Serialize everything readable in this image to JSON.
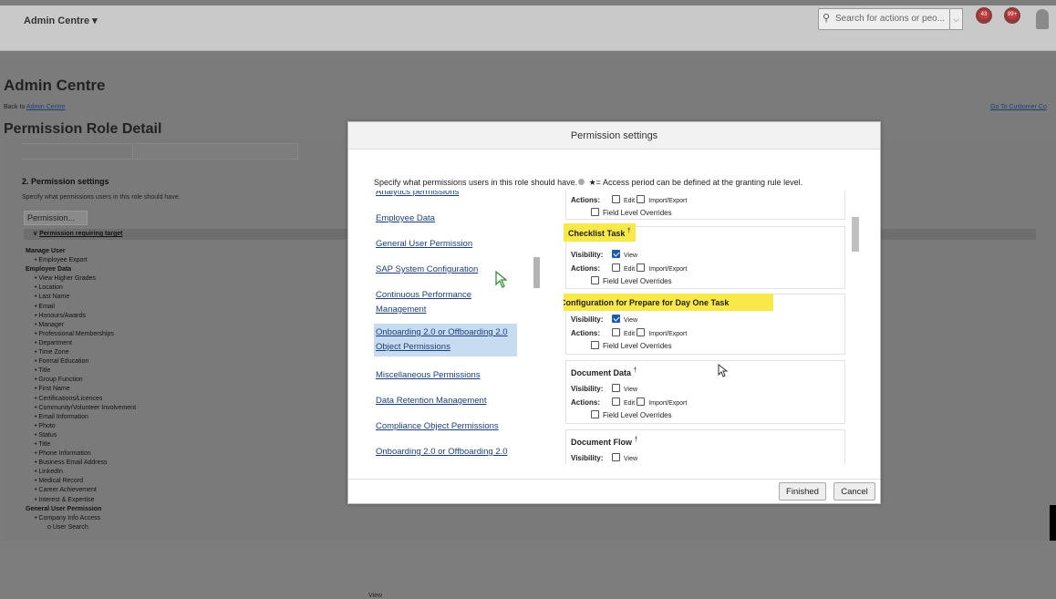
{
  "topbar": {
    "app_title": "Admin Centre ▾",
    "search_placeholder": "Search for actions or peo...",
    "dropdown_icon": "⌵",
    "notif_badges": [
      "43",
      "99+"
    ]
  },
  "page": {
    "heading": "Admin Centre",
    "back_prefix": "Back to ",
    "back_link": "Admin Centre",
    "go_to_link": "Go To Customer Co",
    "subheading": "Permission Role Detail",
    "section_title": "2. Permission settings",
    "section_desc": "Specify what permissions users in this role should have.",
    "permission_button": "Permission...",
    "requiring_target": "Permission requiring target",
    "requiring_target_prefix": "∨ ",
    "tree": [
      {
        "t": "g",
        "text": "Manage User"
      },
      {
        "t": "i",
        "text": "Employee Export"
      },
      {
        "t": "g",
        "text": "Employee Data"
      },
      {
        "t": "i",
        "text": "View Higher Grades"
      },
      {
        "t": "i",
        "text": "Location"
      },
      {
        "t": "i",
        "text": "Last Name"
      },
      {
        "t": "i",
        "text": "Email"
      },
      {
        "t": "i",
        "text": "Honours/Awards"
      },
      {
        "t": "i",
        "text": "Manager"
      },
      {
        "t": "i",
        "text": "Professional Memberships"
      },
      {
        "t": "i",
        "text": "Department"
      },
      {
        "t": "i",
        "text": "Time Zone"
      },
      {
        "t": "i",
        "text": "Formal Education"
      },
      {
        "t": "i",
        "text": "Title"
      },
      {
        "t": "i",
        "text": "Group Function"
      },
      {
        "t": "i",
        "text": "First Name"
      },
      {
        "t": "i",
        "text": "Certifications/Licences"
      },
      {
        "t": "i",
        "text": "Community/Volunteer Involvement"
      },
      {
        "t": "i",
        "text": "Email Information"
      },
      {
        "t": "i",
        "text": "Photo"
      },
      {
        "t": "i",
        "text": "Status"
      },
      {
        "t": "i",
        "text": "Title"
      },
      {
        "t": "i",
        "text": "Phone Information"
      },
      {
        "t": "i",
        "text": "Business Email Address"
      },
      {
        "t": "i",
        "text": "LinkedIn"
      },
      {
        "t": "i",
        "text": "Medical Record"
      },
      {
        "t": "i",
        "text": "Career Achievement"
      },
      {
        "t": "i",
        "text": "Interest & Expertise"
      },
      {
        "t": "g",
        "text": "General User Permission"
      },
      {
        "t": "i",
        "text": "Company Info Access"
      },
      {
        "t": "ii",
        "text": "User Search"
      }
    ],
    "view_text": "View"
  },
  "modal": {
    "title": "Permission settings",
    "description": "Specify what permissions users in this role should have.",
    "description_legend": " ★= Access period can be defined at the granting rule level.",
    "categories": [
      "Analytics permissions",
      "Employee Data",
      "General User Permission",
      "SAP System Configuration",
      "Continuous Performance Management",
      "Onboarding 2.0 or Offboarding 2.0 Object Permissions",
      "Miscellaneous Permissions",
      "Data Retention Management",
      "Compliance Object Permissions",
      "Onboarding 2.0 or Offboarding 2.0"
    ],
    "labels": {
      "visibility": "Visibility:",
      "actions": "Actions:",
      "view": "View",
      "edit": "Edit",
      "import_export": "Import/Export",
      "field_level": "Field Level Overrides",
      "dagger": "†"
    },
    "cards": [
      {
        "title": "",
        "visibility_view": null,
        "edit": false,
        "import_export": false,
        "field_level": false
      },
      {
        "title": "Checklist Task",
        "visibility_view": true,
        "edit": false,
        "import_export": false,
        "field_level": false
      },
      {
        "title": "Configuration for Prepare for Day One Task",
        "visibility_view": true,
        "edit": false,
        "import_export": false,
        "field_level": false
      },
      {
        "title": "Document Data",
        "visibility_view": false,
        "edit": false,
        "import_export": false,
        "field_level": false
      },
      {
        "title": "Document Flow",
        "visibility_view": false
      }
    ],
    "buttons": {
      "finished": "Finished",
      "cancel": "Cancel"
    }
  },
  "colors": {
    "highlight": "#f8e84a",
    "link": "#1c3f7a",
    "selected": "#c7dcf0",
    "overlay": "#7b7b7b"
  }
}
